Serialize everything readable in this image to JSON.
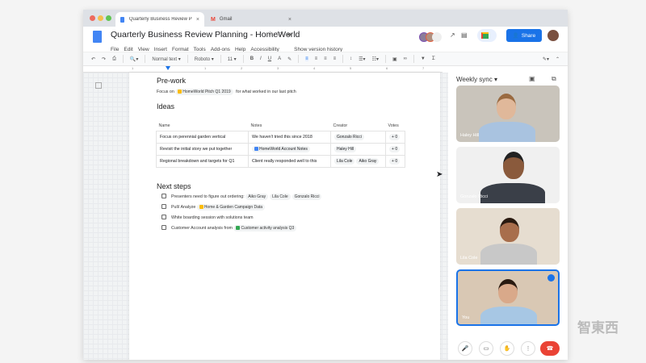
{
  "browser": {
    "tabs": [
      {
        "label": "Quarterly Business Review Plan",
        "icon": "docs-icon",
        "active": true
      },
      {
        "label": "Gmail",
        "icon": "gmail-icon",
        "active": false
      }
    ]
  },
  "doc": {
    "title": "Quarterly Business Review Planning - HomeWorld",
    "menu": [
      "File",
      "Edit",
      "View",
      "Insert",
      "Format",
      "Tools",
      "Add-ons",
      "Help",
      "Accessibility"
    ],
    "version_history": "Show version history",
    "share_label": "Share",
    "toolbar": {
      "style": "Normal text",
      "font": "Roboto",
      "size": "11"
    },
    "ruler": [
      "1",
      "1",
      "2",
      "3",
      "4",
      "5",
      "6",
      "7"
    ]
  },
  "content": {
    "prework": {
      "heading": "Pre-work",
      "prefix": "Focus on",
      "chip": "HomeWorld Pitch Q1 2019",
      "suffix": "for what worked in our last pitch"
    },
    "ideas": {
      "heading": "Ideas",
      "columns": [
        "Name",
        "Notes",
        "Creator",
        "Votes"
      ],
      "rows": [
        {
          "name": "Focus on perennial garden vertical",
          "notes": "We haven't tried this since 2018",
          "creators": [
            "Gonzalo Ricci"
          ],
          "votes": "0"
        },
        {
          "name": "Revisit the initial story we put together",
          "notes": "HomeWorld Account Notes",
          "creators": [
            "Haley Hill"
          ],
          "votes": "0"
        },
        {
          "name": "Regional breakdown and targets for Q1",
          "notes": "Client really responded well to this",
          "creators": [
            "Lila Cole",
            "Aiko Gray"
          ],
          "votes": "0"
        }
      ]
    },
    "next_steps": {
      "heading": "Next steps",
      "items": [
        {
          "text": "Presenters need to figure out ordering:",
          "chips": [
            "Aiko Gray",
            "Lila Cole",
            "Gonzalo Ricci"
          ]
        },
        {
          "text": "Pull/ Analyze",
          "file": "Home & Garden Campaign Data"
        },
        {
          "text": "White boarding session with solutions team"
        },
        {
          "text": "Customer Account analysis from",
          "file": "Customer activity analysis Q3"
        }
      ]
    }
  },
  "meet": {
    "title": "Weekly sync",
    "participants": [
      "Haley Hill",
      "Gonzalo Ricci",
      "Lila Cole",
      "You"
    ],
    "accent": "#1a73e8",
    "end_call_color": "#ea4335"
  },
  "watermark": "智東西"
}
